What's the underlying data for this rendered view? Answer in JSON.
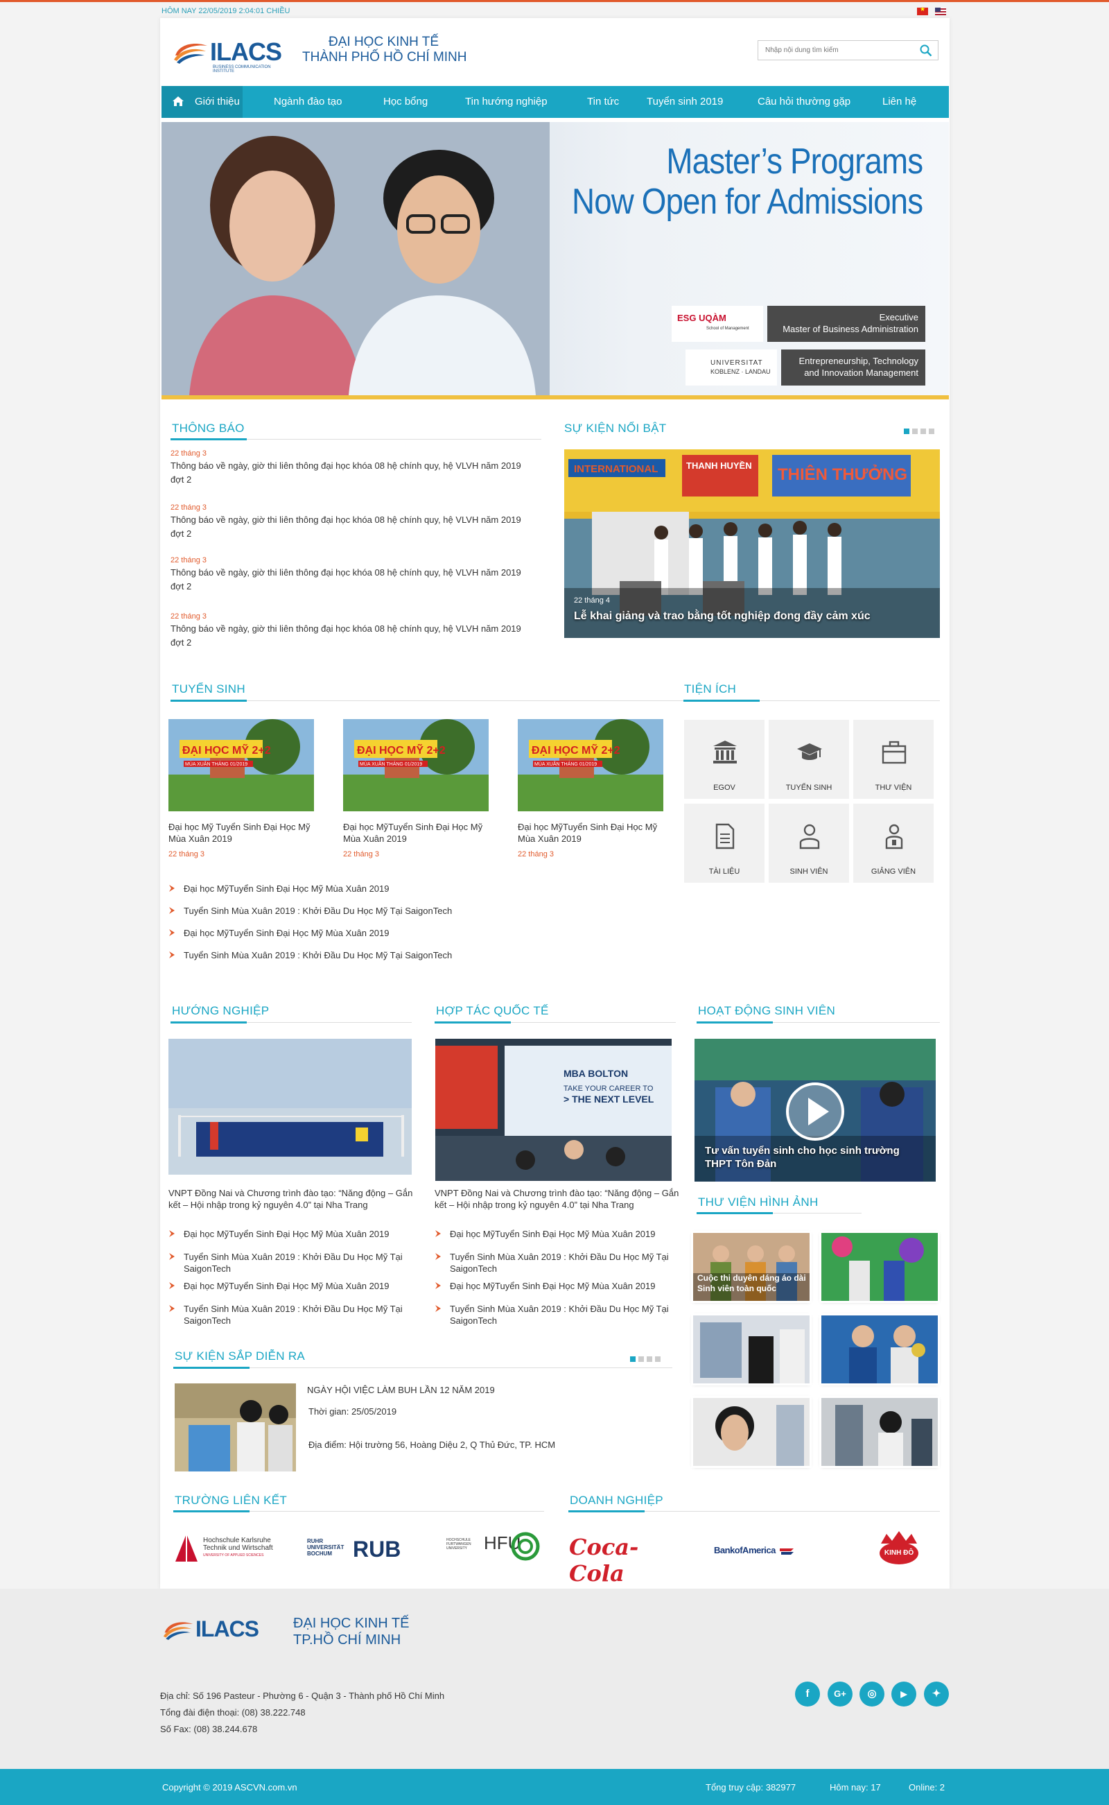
{
  "topbar": {
    "date": "HÔM NAY 22/05/2019 2:04:01 CHIỀU"
  },
  "header": {
    "logo_text": "ILACS",
    "logo_sub": "BUSINESS COMMUNICATION INSTITUTE",
    "uni_line1": "ĐẠI HỌC KINH TẾ",
    "uni_line2": "THÀNH PHỐ HỒ CHÍ MINH",
    "search_placeholder": "Nhập nội dung tìm kiếm"
  },
  "nav": {
    "items": [
      "Giới thiệu",
      "Ngành đào tạo",
      "Học bổng",
      "Tin hướng nghiệp",
      "Tin tức",
      "Tuyển sinh 2019",
      "Câu hỏi thường gặp",
      "Liên hệ"
    ]
  },
  "banner": {
    "headline1": "Master’s Programs",
    "headline2": "Now Open for Admissions",
    "box1_l1": "Executive",
    "box1_l2": "Master of Business Administration",
    "box2_l1": "Entrepreneurship, Technology",
    "box2_l2": "and Innovation Management",
    "logo1": "ESG UQÀM",
    "logo1_sub": "School of Management",
    "logo2": "UNIVERSITAT",
    "logo2_sub": "KOBLENZ · LANDAU"
  },
  "notices": {
    "title": "THÔNG BÁO",
    "items": [
      {
        "date": "22 tháng 3",
        "text": "Thông báo về ngày, giờ thi liên thông đại học khóa 08 hệ chính quy, hệ VLVH năm 2019 đợt 2"
      },
      {
        "date": "22 tháng 3",
        "text": "Thông báo về ngày, giờ thi liên thông đại học khóa 08 hệ chính quy, hệ VLVH năm 2019 đợt 2"
      },
      {
        "date": "22 tháng 3",
        "text": "Thông báo về ngày, giờ thi liên thông đại học khóa 08 hệ chính quy, hệ VLVH năm 2019 đợt 2"
      },
      {
        "date": "22 tháng 3",
        "text": "Thông báo về ngày, giờ thi liên thông đại học khóa 08 hệ chính quy, hệ VLVH năm 2019 đợt 2"
      }
    ]
  },
  "featured": {
    "title": "SỰ KIỆN NỔI BẬT",
    "date": "22 tháng 4",
    "caption": "Lễ khai giảng và trao bằng tốt nghiệp đong đầy cảm xúc",
    "sign1": "INTERNATIONAL",
    "sign2": "THANH HUYỀN",
    "sign3": "THIÊN THƯỞNG"
  },
  "admission": {
    "title": "TUYỂN SINH",
    "img_label": "ĐẠI HỌC MỸ 2+2",
    "img_sub": "MÙA XUÂN THÁNG 01/2019",
    "cards": [
      {
        "title": "Đại học Mỹ Tuyển Sinh Đại Học Mỹ Mùa Xuân 2019",
        "date": "22 tháng 3"
      },
      {
        "title": "Đại học MỹTuyển Sinh Đại Học Mỹ Mùa Xuân 2019",
        "date": "22 tháng 3"
      },
      {
        "title": "Đại học MỹTuyển Sinh Đại Học Mỹ Mùa Xuân 2019",
        "date": "22 tháng 3"
      }
    ],
    "links": [
      "Đại học MỹTuyển Sinh Đại Học Mỹ Mùa Xuân 2019",
      "Tuyển Sinh Mùa Xuân 2019 : Khởi Đầu Du Học Mỹ Tại SaigonTech",
      "Đại học MỹTuyển Sinh Đại Học Mỹ Mùa Xuân 2019",
      "Tuyển Sinh Mùa Xuân 2019 : Khởi Đầu Du Học Mỹ Tại SaigonTech"
    ]
  },
  "utilities": {
    "title": "TIỆN ÍCH",
    "items": [
      "EGOV",
      "TUYỂN SINH",
      "THƯ VIỆN",
      "TÀI LIỆU",
      "SINH VIÊN",
      "GIẢNG VIÊN"
    ]
  },
  "career": {
    "title": "HƯỚNG NGHIỆP",
    "headline": "VNPT Đồng Nai và Chương trình đào tạo: “Năng động – Gắn kết – Hội nhập trong kỷ nguyên 4.0” tại Nha Trang",
    "links": [
      "Đại học MỹTuyển Sinh Đại Học Mỹ Mùa Xuân 2019",
      "Tuyển Sinh Mùa Xuân 2019 : Khởi Đầu Du Học Mỹ Tại SaigonTech",
      "Đại học MỹTuyển Sinh Đại Học Mỹ Mùa Xuân 2019",
      "Tuyển Sinh Mùa Xuân 2019 : Khởi Đầu Du Học Mỹ Tại SaigonTech"
    ]
  },
  "cooperation": {
    "title": "HỢP TÁC QUỐC TẾ",
    "screen1": "MBA BOLTON",
    "screen2": "TAKE YOUR CAREER TO",
    "screen3": "> THE NEXT LEVEL",
    "headline": "VNPT Đồng Nai và Chương trình đào tạo: “Năng động – Gắn kết – Hội nhập trong kỷ nguyên 4.0” tại Nha Trang",
    "links": [
      "Đại học MỹTuyển Sinh Đại Học Mỹ Mùa Xuân 2019",
      "Tuyển Sinh Mùa Xuân 2019 : Khởi Đầu Du Học Mỹ Tại SaigonTech",
      "Đại học MỹTuyển Sinh Đại Học Mỹ Mùa Xuân 2019",
      "Tuyển Sinh Mùa Xuân 2019 : Khởi Đầu Du Học Mỹ Tại SaigonTech"
    ]
  },
  "student": {
    "title": "HOẠT ĐỘNG SINH VIÊN",
    "caption": "Tư vấn tuyển sinh cho học sinh trường THPT Tôn Đản"
  },
  "gallery": {
    "title": "THƯ VIỆN HÌNH ẢNH",
    "caption": "Cuộc thi duyên dáng áo dài Sinh viên toàn quốc"
  },
  "upcoming": {
    "title": "SỰ KIỆN SẮP DIỄN RA",
    "event": "NGÀY HỘI VIỆC LÀM BUH LẦN 12 NĂM 2019",
    "time": "Thời gian: 25/05/2019",
    "place": "Địa điểm: Hội trường 56, Hoàng Diệu 2, Q Thủ Đức, TP. HCM"
  },
  "partners": {
    "schools_title": "TRƯỜNG LIÊN KẾT",
    "business_title": "DOANH NGHIỆP",
    "hska1": "Hochschule Karlsruhe",
    "hska2": "Technik und Wirtschaft",
    "hska3": "UNIVERSITY OF APPLIED SCIENCES",
    "rub_small1": "RUHR",
    "rub_small2": "UNIVERSITÄT",
    "rub_small3": "BOCHUM",
    "rub": "RUB",
    "hfu": "HFU",
    "hfu_small": "HOCHSCHULE FURTWANGEN UNIVERSITY",
    "coca": "Coca-Cola",
    "boa": "BankofAmerica",
    "kinhdo": "KINH ĐÔ"
  },
  "footer": {
    "logo_text": "ILACS",
    "name1": "ĐẠI HỌC KINH TẾ",
    "name2": "TP.HỒ CHÍ MINH",
    "address": "Địa chỉ: Số 196 Pasteur - Phường 6 - Quận 3 - Thành phố Hồ Chí Minh",
    "phone": "Tổng đài điện thoại: (08) 38.222.748",
    "fax": "Số Fax: (08) 38.244.678",
    "social": [
      "f",
      "G+",
      "◎",
      "▶",
      "✦"
    ],
    "copyright": "Copyright © 2019 ASCVN.com.vn",
    "total_visits": "Tổng truy cập: 382977",
    "today": "Hôm nay: 17",
    "online": "Online: 2"
  },
  "colors": {
    "accent": "#1aa6c4",
    "orange": "#e15a2c",
    "brand_blue": "#1a5a9a"
  }
}
